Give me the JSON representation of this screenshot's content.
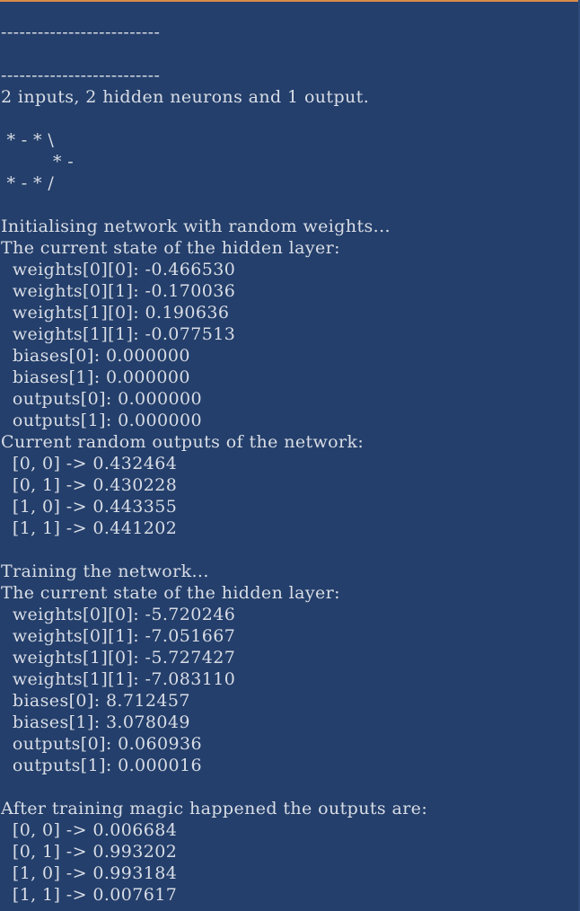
{
  "console": {
    "lines": [
      "--------------------------",
      "",
      "--------------------------",
      "2 inputs, 2 hidden neurons and 1 output.",
      "",
      " * - * \\",
      "         * -",
      " * - * /",
      "",
      "Initialising network with random weights...",
      "The current state of the hidden layer:",
      "  weights[0][0]: -0.466530",
      "  weights[0][1]: -0.170036",
      "  weights[1][0]: 0.190636",
      "  weights[1][1]: -0.077513",
      "  biases[0]: 0.000000",
      "  biases[1]: 0.000000",
      "  outputs[0]: 0.000000",
      "  outputs[1]: 0.000000",
      "Current random outputs of the network:",
      "  [0, 0] -> 0.432464",
      "  [0, 1] -> 0.430228",
      "  [1, 0] -> 0.443355",
      "  [1, 1] -> 0.441202",
      "",
      "Training the network...",
      "The current state of the hidden layer:",
      "  weights[0][0]: -5.720246",
      "  weights[0][1]: -7.051667",
      "  weights[1][0]: -5.727427",
      "  weights[1][1]: -7.083110",
      "  biases[0]: 8.712457",
      "  biases[1]: 3.078049",
      "  outputs[0]: 0.060936",
      "  outputs[1]: 0.000016",
      "",
      "After training magic happened the outputs are:",
      "  [0, 0] -> 0.006684",
      "  [0, 1] -> 0.993202",
      "  [1, 0] -> 0.993184",
      "  [1, 1] -> 0.007617"
    ]
  },
  "colors": {
    "background": "#243f6b",
    "text": "#d9dde6",
    "top_border": "#d98c4a"
  }
}
